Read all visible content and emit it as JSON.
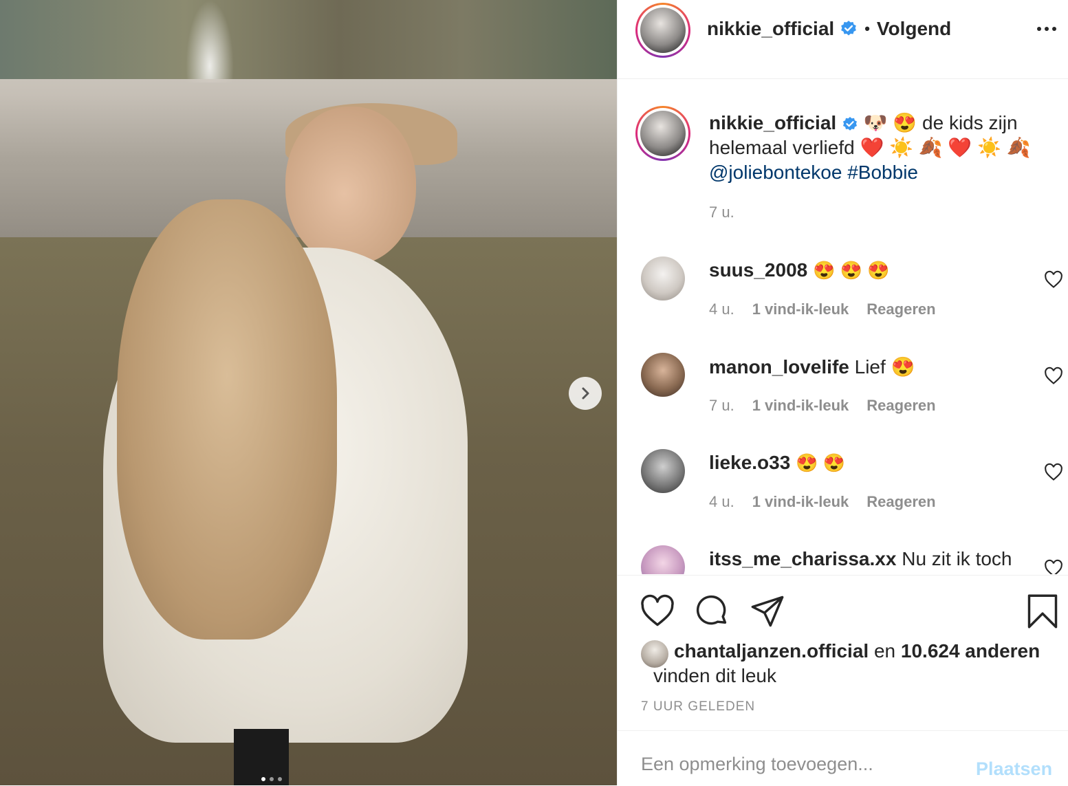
{
  "post": {
    "username": "nikkie_official",
    "follow_status": "Volgend",
    "caption": {
      "username": "nikkie_official",
      "text_part1": "🐶 😍  de kids zijn helemaal verliefd ❤️ ☀️ 🍂 ❤️ ☀️ 🍂",
      "mention": "@joliebontekoe",
      "hashtag": "#Bobbie",
      "time": "7 u."
    }
  },
  "comments": [
    {
      "username": "suus_2008",
      "text": "😍 😍 😍",
      "time": "4 u.",
      "likes": "1 vind-ik-leuk",
      "reply": "Reageren"
    },
    {
      "username": "manon_lovelife",
      "text": "Lief 😍",
      "time": "7 u.",
      "likes": "1 vind-ik-leuk",
      "reply": "Reageren"
    },
    {
      "username": "lieke.o33",
      "text": "😍 😍",
      "time": "4 u.",
      "likes": "1 vind-ik-leuk",
      "reply": "Reageren"
    },
    {
      "username": "itss_me_charissa.xx",
      "text": "Nu zit ik toch"
    }
  ],
  "likes": {
    "user": "chantaljanzen.official",
    "connector": "en",
    "others": "10.624 anderen",
    "suffix": "vinden dit leuk"
  },
  "timestamp": "7 UUR GELEDEN",
  "add_comment": {
    "placeholder": "Een opmerking toevoegen...",
    "post_label": "Plaatsen"
  },
  "colors": {
    "link": "#00376b",
    "verified": "#3897f0",
    "post_button": "#b2dffc"
  },
  "carousel": {
    "current": 1,
    "total": 3
  }
}
